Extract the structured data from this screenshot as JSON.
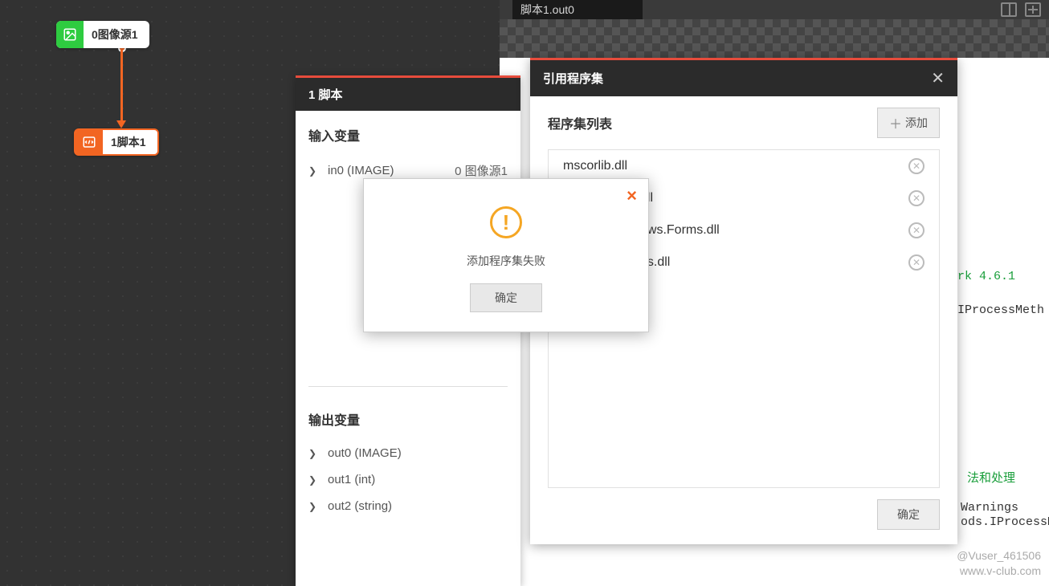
{
  "preview": {
    "tab_label": "脚本1.out0"
  },
  "nodes": {
    "source": {
      "label": "0图像源1"
    },
    "script": {
      "label": "1脚本1"
    }
  },
  "script_panel": {
    "title": "1 脚本",
    "inputs_title": "输入变量",
    "inputs": [
      {
        "name": "in0 (IMAGE)",
        "value": "0 图像源1"
      }
    ],
    "outputs_title": "输出变量",
    "outputs": [
      {
        "name": "out0 (IMAGE)"
      },
      {
        "name": "out1 (int)"
      },
      {
        "name": "out2 (string)"
      }
    ]
  },
  "assembly_dialog": {
    "title": "引用程序集",
    "list_title": "程序集列表",
    "add_label": "添加",
    "ok_label": "确定",
    "items": [
      "mscorlib.dll",
      "dll",
      "ows.Forms.dll",
      "ds.dll"
    ]
  },
  "alert": {
    "message": "添加程序集失败",
    "ok_label": "确定"
  },
  "code_fragments": {
    "fw": "rk 4.6.1",
    "iface1": "IProcessMeth",
    "comment": "法和处理",
    "warn": "Warnings",
    "iface2": "ods.IProcessMet"
  },
  "watermark": {
    "user": "@Vuser_461506",
    "site": "www.v-club.com"
  }
}
